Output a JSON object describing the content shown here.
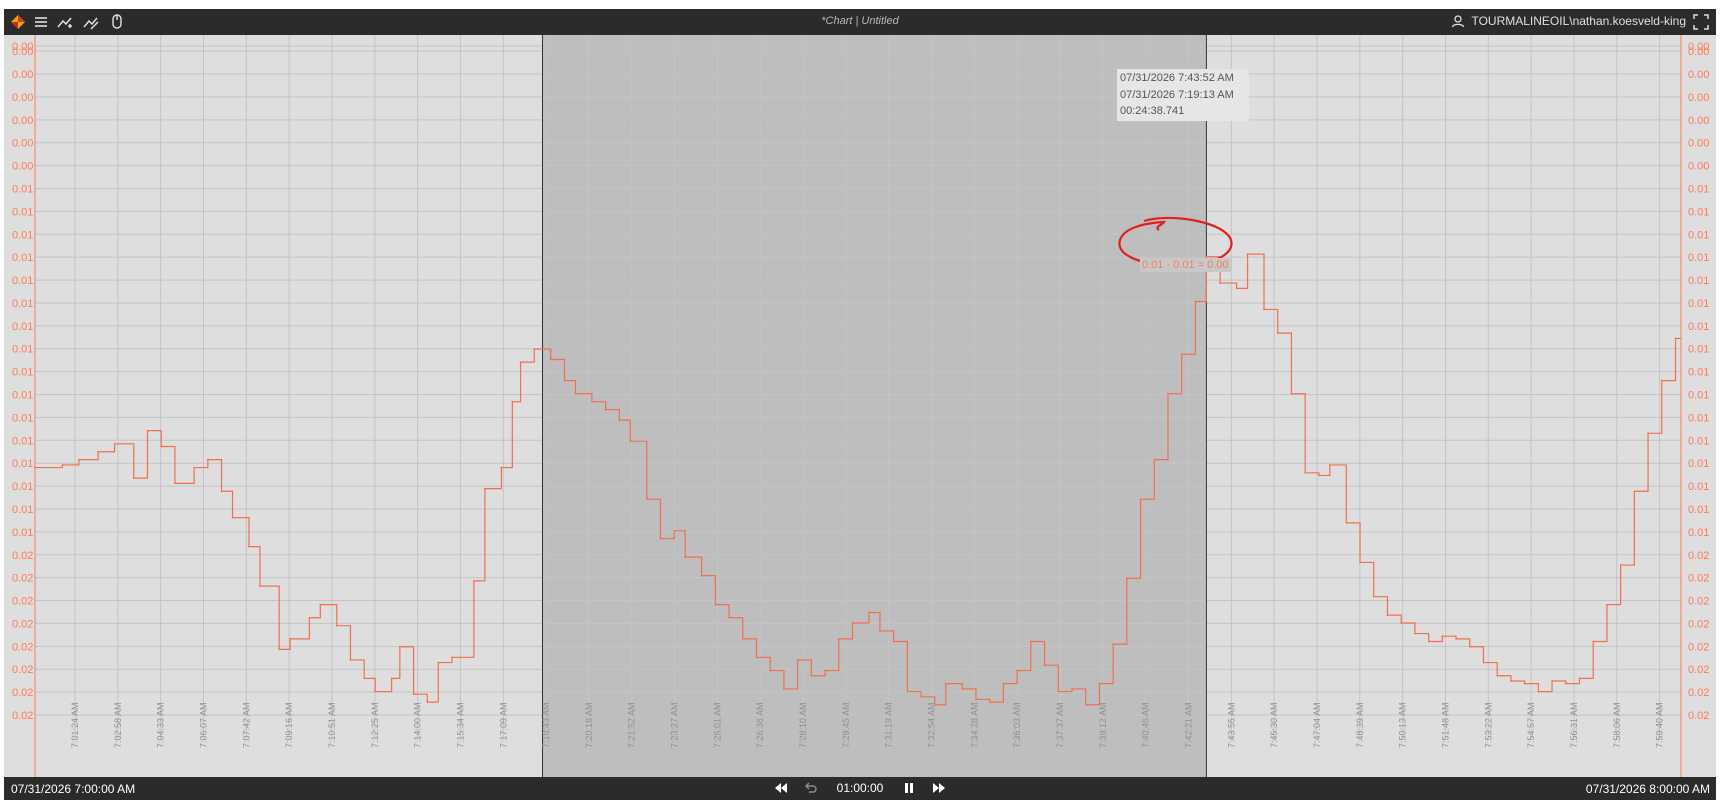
{
  "toolbar": {
    "title": "*Chart | Untitled",
    "user": "TOURMALINEOIL\\nathan.koesveld-king",
    "icons": [
      "app-logo-icon",
      "menu-icon",
      "add-trend-icon",
      "edit-trend-icon",
      "mouse-icon",
      "user-icon",
      "fullscreen-icon"
    ]
  },
  "selection_tooltip": {
    "end_time": "07/31/2026 7:43:52 AM",
    "start_time": "07/31/2026 7:19:13 AM",
    "duration": "00:24:38.741"
  },
  "difference_label": "0.01 - 0.01 = 0.00",
  "bottom_bar": {
    "start": "07/31/2026  7:00:00 AM",
    "end": "07/31/2026  8:00:00 AM",
    "duration": "01:00:00"
  },
  "colors": {
    "series": "#f07050",
    "axis_label": "#ff7a55",
    "plot_bg": "#dedede",
    "selection": "#bebebe",
    "annotation": "#e02020",
    "bar_bg": "#2b2b2b"
  },
  "chart_data": {
    "type": "line",
    "step": true,
    "x_unit": "minutes after 07/31/2026 7:00:00 AM",
    "xlim": [
      0,
      60
    ],
    "ylim": [
      0.0,
      0.0255
    ],
    "y_tick_values": [
      0.0007,
      0.0022,
      0.0037,
      0.0052,
      0.0067,
      0.0082,
      0.0097,
      0.0112,
      0.0127,
      0.0142,
      0.0157,
      0.0172,
      0.0187,
      0.0202,
      0.0217,
      0.0232,
      0.0247,
      0.0254
    ],
    "y_tick_labels": [
      "0.00",
      "0.00",
      "0.00",
      "0.00",
      "0.00",
      "0.00",
      "0.00",
      "0.01",
      "0.01",
      "0.01",
      "0.01",
      "0.01",
      "0.01",
      "0.01",
      "0.01",
      "0.01",
      "0.01",
      "0.01",
      "0.01",
      "0.01",
      "0.01",
      "0.01",
      "0.01",
      "0.02",
      "0.02",
      "0.02",
      "0.02",
      "0.02",
      "0.02",
      "0.02",
      "0.02"
    ],
    "x_tick_labels": [
      "7:01:24 AM",
      "7:02:58 AM",
      "7:04:33 AM",
      "7:06:07 AM",
      "7:07:42 AM",
      "7:09:16 AM",
      "7:10:51 AM",
      "7:12:25 AM",
      "7:14:00 AM",
      "7:15:34 AM",
      "7:17:09 AM",
      "7:18:43 AM",
      "7:20:18 AM",
      "7:21:52 AM",
      "7:23:27 AM",
      "7:25:01 AM",
      "7:26:36 AM",
      "7:28:10 AM",
      "7:29:45 AM",
      "7:31:19 AM",
      "7:32:54 AM",
      "7:34:28 AM",
      "7:36:03 AM",
      "7:37:37 AM",
      "7:39:12 AM",
      "7:40:46 AM",
      "7:42:21 AM",
      "7:43:55 AM",
      "7:45:30 AM",
      "7:47:04 AM",
      "7:48:39 AM",
      "7:50:13 AM",
      "7:51:48 AM",
      "7:53:22 AM",
      "7:54:57 AM",
      "7:56:31 AM",
      "7:58:06 AM",
      "7:59:40 AM"
    ],
    "selection": {
      "start_min": 18.5,
      "end_min": 42.7
    },
    "series": [
      {
        "x": [
          0,
          1,
          1.6,
          2.3,
          2.9,
          3.6,
          4.1,
          4.6,
          5.1,
          5.8,
          6.3,
          6.8,
          7.2,
          7.8,
          8.2,
          8.9,
          9.3,
          10.0,
          10.4,
          11.0,
          11.5,
          12.0,
          12.4,
          13.0,
          13.3,
          13.8,
          14.3,
          14.7,
          15.2,
          16.0,
          16.4,
          17.0,
          17.4,
          17.7,
          18.2,
          18.8,
          19.3,
          19.7,
          20.3,
          20.8,
          21.3,
          21.7,
          22.3,
          22.8,
          23.3,
          23.7,
          24.3,
          24.8,
          25.3,
          25.8,
          26.3,
          26.8,
          27.3,
          27.8,
          28.3,
          28.8,
          29.3,
          29.8,
          30.4,
          30.8,
          31.3,
          31.8,
          32.3,
          32.8,
          33.2,
          33.8,
          34.3,
          34.8,
          35.3,
          35.8,
          36.3,
          36.8,
          37.3,
          37.8,
          38.3,
          38.8,
          39.3,
          39.8,
          40.3,
          40.8,
          41.3,
          41.8,
          42.3,
          42.7,
          43.2,
          43.8,
          44.2,
          44.8,
          45.3,
          45.8,
          46.3,
          46.8,
          47.2,
          47.8,
          48.3,
          48.8,
          49.3,
          49.8,
          50.3,
          50.8,
          51.3,
          51.8,
          52.3,
          52.8,
          53.3,
          53.8,
          54.3,
          54.8,
          55.3,
          55.8,
          56.3,
          56.8,
          57.3,
          57.8,
          58.3,
          58.8,
          59.3,
          59.8
        ],
        "y": [
          0.0092,
          0.0093,
          0.0095,
          0.0098,
          0.0101,
          0.0088,
          0.0106,
          0.01,
          0.0086,
          0.0092,
          0.0095,
          0.0083,
          0.0073,
          0.0062,
          0.0047,
          0.0023,
          0.0027,
          0.0035,
          0.004,
          0.0032,
          0.0019,
          0.0012,
          0.0007,
          0.0012,
          0.0024,
          0.0006,
          0.0003,
          0.0018,
          0.002,
          0.0049,
          0.0084,
          0.0092,
          0.0117,
          0.0132,
          0.0137,
          0.0133,
          0.0125,
          0.012,
          0.0117,
          0.0114,
          0.011,
          0.0102,
          0.008,
          0.0065,
          0.0068,
          0.0058,
          0.0051,
          0.004,
          0.0035,
          0.0027,
          0.002,
          0.0015,
          0.0008,
          0.0019,
          0.0013,
          0.0015,
          0.0027,
          0.0033,
          0.0037,
          0.003,
          0.0026,
          0.0007,
          0.0005,
          0.0002,
          0.001,
          0.0008,
          0.0004,
          0.0003,
          0.001,
          0.0015,
          0.0026,
          0.0017,
          0.0007,
          0.0008,
          0.0002,
          0.001,
          0.0025,
          0.005,
          0.008,
          0.0095,
          0.012,
          0.0135,
          0.0155,
          0.0172,
          0.0162,
          0.016,
          0.0173,
          0.0152,
          0.0143,
          0.012,
          0.009,
          0.0089,
          0.0093,
          0.0071,
          0.0056,
          0.0043,
          0.0036,
          0.0033,
          0.0029,
          0.0026,
          0.0028,
          0.0027,
          0.0024,
          0.0018,
          0.0013,
          0.0011,
          0.001,
          0.0007,
          0.0011,
          0.001,
          0.0012,
          0.0026,
          0.004,
          0.0055,
          0.0083,
          0.0105,
          0.0125,
          0.0141
        ]
      }
    ]
  }
}
